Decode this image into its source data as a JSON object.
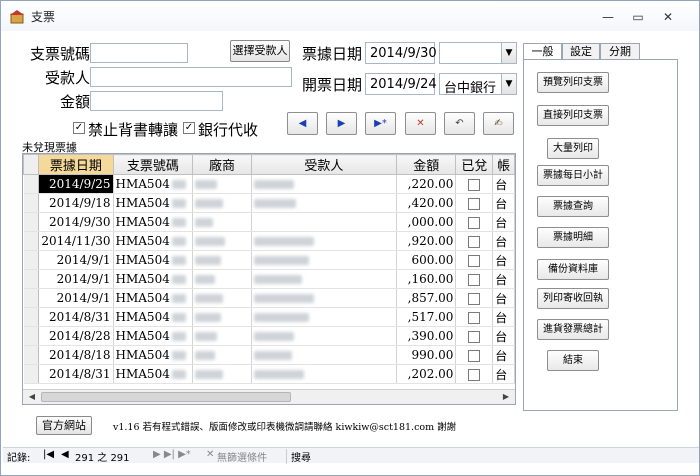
{
  "window": {
    "title": "支票"
  },
  "form": {
    "check_no_label": "支票號碼",
    "check_no_value": "",
    "payee_label": "受款人",
    "payee_value": "",
    "amount_label": "金額",
    "amount_value": "",
    "select_payee_button": "選擇受款人",
    "check_date_label": "票據日期",
    "check_date_value": "2014/9/30",
    "issue_date_label": "開票日期",
    "issue_date_value": "2014/9/24",
    "bank_value": "台中銀行",
    "no_endorse_label": "禁止背書轉讓",
    "no_endorse_checked": true,
    "bank_agent_label": "銀行代收",
    "bank_agent_checked": true
  },
  "nav": {
    "prev": "◀",
    "next": "▶",
    "new": "▶*",
    "delete": "✕",
    "undo": "↶",
    "save": "✍"
  },
  "grid": {
    "caption": "未兌現票據",
    "columns": [
      "票據日期",
      "支票號碼",
      "廠商",
      "受款人",
      "金額",
      "已兌",
      "帳"
    ],
    "rows": [
      {
        "date": "2014/9/25",
        "check_no": "HMA504",
        "amount": ",220.00",
        "cashed": false,
        "acct": "台"
      },
      {
        "date": "2014/9/18",
        "check_no": "HMA504",
        "amount": ",420.00",
        "cashed": false,
        "acct": "台"
      },
      {
        "date": "2014/9/30",
        "check_no": "HMA504",
        "amount": ",000.00",
        "cashed": false,
        "acct": "台"
      },
      {
        "date": "2014/11/30",
        "check_no": "HMA504",
        "amount": ",920.00",
        "cashed": false,
        "acct": "台"
      },
      {
        "date": "2014/9/1",
        "check_no": "HMA504",
        "amount": "600.00",
        "cashed": false,
        "acct": "台"
      },
      {
        "date": "2014/9/1",
        "check_no": "HMA504",
        "amount": ",160.00",
        "cashed": false,
        "acct": "台"
      },
      {
        "date": "2014/9/1",
        "check_no": "HMA504",
        "amount": ",857.00",
        "cashed": false,
        "acct": "台"
      },
      {
        "date": "2014/8/31",
        "check_no": "HMA504",
        "amount": ",517.00",
        "cashed": false,
        "acct": "台"
      },
      {
        "date": "2014/8/28",
        "check_no": "HMA504",
        "amount": ",390.00",
        "cashed": false,
        "acct": "台"
      },
      {
        "date": "2014/8/18",
        "check_no": "HMA504",
        "amount": "990.00",
        "cashed": false,
        "acct": "台"
      },
      {
        "date": "2014/8/31",
        "check_no": "HMA504",
        "amount": ",202.00",
        "cashed": false,
        "acct": "台"
      }
    ]
  },
  "tabs": [
    "一般",
    "設定",
    "分期"
  ],
  "side_buttons": [
    "預覽列印支票",
    "直接列印支票",
    "大量列印",
    "票據每日小計",
    "票據查詢",
    "票據明細",
    "備份資料庫",
    "列印寄收回執",
    "進貨發票總計",
    "結束"
  ],
  "footer": {
    "website_button": "官方網站",
    "version_text": "v1.16 若有程式錯誤、版面修改或印表機微調請聯絡 kiwkiw@sct181.com 謝謝"
  },
  "statusbar": {
    "record_label": "記錄:",
    "record_position": "291 之 291",
    "no_filter": "無篩選條件",
    "search": "搜尋"
  },
  "colors": {
    "title_bar": "#f3f6fb",
    "selected_cell": "#000000",
    "nav_arrow": "#1a3fb5"
  }
}
